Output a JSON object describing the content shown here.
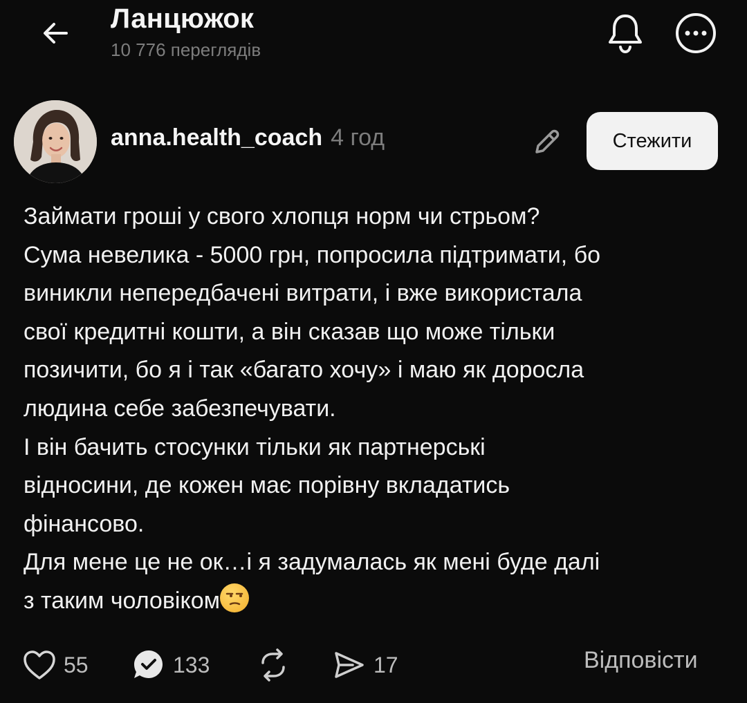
{
  "header": {
    "title": "Ланцюжок",
    "views": "10 776 переглядів"
  },
  "post": {
    "author": "anna.health_coach",
    "time": "4 год",
    "follow_label": "Стежити",
    "lines": [
      "Займати гроші у свого хлопця норм чи стрьом?",
      "Сума невелика - 5000 грн, попросила підтримати, бо",
      "виникли непередбачені витрати, і вже використала",
      "свої кредитні кошти, а він сказав що може тільки",
      "позичити, бо я і так «багато хочу» і маю як доросла",
      "людина себе забезпечувати.",
      "І він бачить стосунки тільки як партнерські",
      "відносини, де кожен має порівну вкладатись",
      "фінансово.",
      "Для мене це не ок…і я задумалась як мені буде далі",
      "з таким чоловіком"
    ],
    "emoji": "unamused-face-emoji"
  },
  "actions": {
    "likes": "55",
    "replies": "133",
    "shares": "17",
    "reply_label": "Відповісти"
  },
  "icons": {
    "back": "arrow-left-icon",
    "bell": "bell-icon",
    "more": "more-horizontal-icon",
    "edit": "pencil-icon",
    "like": "heart-icon",
    "comment": "comment-check-icon",
    "repost": "repost-icon",
    "send": "send-icon"
  },
  "colors": {
    "background": "#0b0b0b",
    "text": "#f1f1f1",
    "muted": "#7d7d7d",
    "button_bg": "#f2f2f2"
  }
}
